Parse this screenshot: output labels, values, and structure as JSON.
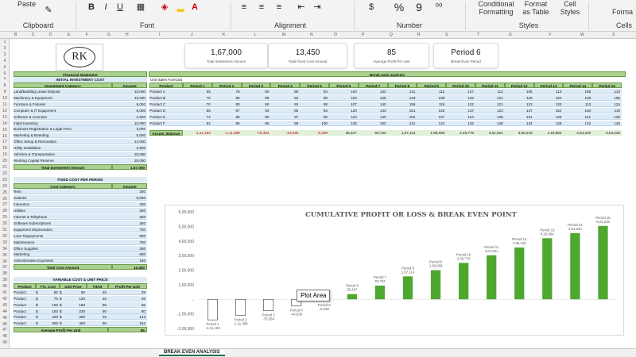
{
  "ribbon": {
    "paste_label": "Paste",
    "groups": [
      "Clipboard",
      "Font",
      "Alignment",
      "Number",
      "Styles",
      "Cells"
    ],
    "styles_buttons": [
      "Conditional Formatting",
      "Format as Table",
      "Cell Styles"
    ],
    "cells_button": "Forma",
    "number_symbols": [
      "%",
      "9"
    ]
  },
  "columns": [
    "B",
    "C",
    "D",
    "E",
    "F",
    "G",
    "H",
    "I",
    "J",
    "K",
    "L",
    "M",
    "N",
    "O",
    "P",
    "Q",
    "R",
    "S",
    "T",
    "U",
    "V",
    "W",
    "X"
  ],
  "rows": [
    "1",
    "2",
    "3",
    "4",
    "5",
    "6",
    "7",
    "8",
    "9",
    "10",
    "11",
    "12",
    "13",
    "14",
    "15",
    "16",
    "17",
    "18",
    "19",
    "20",
    "21",
    "22",
    "23",
    "24",
    "25",
    "26",
    "27",
    "28",
    "29",
    "30",
    "31",
    "32",
    "33",
    "34",
    "35",
    "36",
    "37",
    "38",
    "39",
    "40",
    "41",
    "42",
    "43",
    "44",
    "45",
    "46",
    "47",
    "48",
    "49"
  ],
  "logo_text": "RK",
  "kpis": [
    {
      "value": "1,67,000",
      "label": "Total Investment Amount"
    },
    {
      "value": "13,450",
      "label": "Total Fixed Cost Amount"
    },
    {
      "value": "85",
      "label": "Average Profit Per Unit"
    },
    {
      "value": "Period 6",
      "label": "Break Even Period"
    }
  ],
  "financial_statement": "Financial Statement",
  "break_even_title": "Break even analysis",
  "initial_investment": {
    "title": "INITIAL INVESTMENT COST",
    "col1": "Investment Category",
    "col2": "Amount",
    "rows": [
      [
        "Land/Building Lease Deposit",
        "15,000"
      ],
      [
        "Machinery & Equipment",
        "45,000"
      ],
      [
        "Furniture & Fixtures",
        "8,000"
      ],
      [
        "Computer & IT Equipment",
        "6,000"
      ],
      [
        "Software & Licenses",
        "2,500"
      ],
      [
        "Initial Inventory",
        "10,000"
      ],
      [
        "Business Registration & Legal Fees",
        "3,000"
      ],
      [
        "Marketing & Branding",
        "5,000"
      ],
      [
        "Office Setup & Renovation",
        "12,000"
      ],
      [
        "Utility Installation",
        "2,500"
      ],
      [
        "Vehicles & Transportation",
        "20,000"
      ],
      [
        "Working Capital Reserve",
        "20,000"
      ]
    ],
    "total_label": "Total Investment Amount",
    "total": "1,67,000"
  },
  "fixed_cost": {
    "title": "FIXED COST PER PERIOD",
    "col1": "Cost Category",
    "col2": "Amount",
    "rows": [
      [
        "Rent",
        "300"
      ],
      [
        "Salaries",
        "5,000"
      ],
      [
        "Insurance",
        "400"
      ],
      [
        "Utilities",
        "300"
      ],
      [
        "Internet & Telephone",
        "250"
      ],
      [
        "Software Subscriptions",
        "250"
      ],
      [
        "Equipment Depreciation",
        "700"
      ],
      [
        "Loan Repayments",
        "900"
      ],
      [
        "Maintenance",
        "700"
      ],
      [
        "Office Supplies",
        "300"
      ],
      [
        "Marketing",
        "600"
      ],
      [
        "Administrative Expenses",
        "150"
      ]
    ],
    "total_label": "Total Cost Amount",
    "total": "13,450"
  },
  "variable_cost": {
    "title": "VARIABLE COST & UNIT PRICE",
    "headers": [
      "Product",
      "TTL Cost",
      "Unit Price",
      "TtlAtt",
      "Profit Per Unit"
    ],
    "rows": [
      [
        "Product",
        "$",
        "50",
        "$",
        "80",
        "45",
        "29"
      ],
      [
        "Product",
        "$",
        "75",
        "$",
        "120",
        "45",
        "45"
      ],
      [
        "Product",
        "$",
        "100",
        "$",
        "160",
        "95",
        "55"
      ],
      [
        "Product",
        "$",
        "150",
        "$",
        "230",
        "90",
        "80"
      ],
      [
        "Product",
        "$",
        "200",
        "$",
        "350",
        "45",
        "143"
      ],
      [
        "Product",
        "$",
        "300",
        "$",
        "450",
        "90",
        "152"
      ]
    ],
    "avg_label": "Average Profit Per Unit",
    "avg": "85"
  },
  "unit_sales": {
    "title": "Unit Sales Forecast",
    "headers": [
      "Product",
      "Period 1",
      "Period 2",
      "Period 3",
      "Period 4",
      "Period 5",
      "Period 6",
      "Period 7",
      "Period 8",
      "Period 9",
      "Period 10",
      "Period 11",
      "Period 12",
      "Period 13",
      "Period 14",
      "Period 15"
    ],
    "rows": [
      [
        "Product A",
        "65",
        "78",
        "80",
        "90",
        "93",
        "100",
        "132",
        "141",
        "112",
        "127",
        "112",
        "105",
        "113",
        "165",
        "110"
      ],
      [
        "Product B",
        "76",
        "85",
        "89",
        "92",
        "98",
        "110",
        "125",
        "143",
        "109",
        "132",
        "121",
        "119",
        "122",
        "108",
        "105"
      ],
      [
        "Product C",
        "70",
        "80",
        "90",
        "93",
        "98",
        "107",
        "140",
        "156",
        "119",
        "122",
        "121",
        "123",
        "133",
        "113",
        "124"
      ],
      [
        "Product D",
        "85",
        "87",
        "93",
        "95",
        "93",
        "120",
        "143",
        "161",
        "102",
        "137",
        "123",
        "147",
        "152",
        "184",
        "119"
      ],
      [
        "Product E",
        "74",
        "86",
        "95",
        "97",
        "95",
        "110",
        "140",
        "154",
        "107",
        "124",
        "138",
        "151",
        "149",
        "121",
        "135"
      ],
      [
        "Product F",
        "82",
        "85",
        "96",
        "98",
        "100",
        "125",
        "152",
        "141",
        "124",
        "132",
        "146",
        "134",
        "148",
        "122",
        "145"
      ]
    ],
    "accum_label": "Accum. Balance",
    "accum": [
      "-1,41,183",
      "-1,11,388",
      "-78,384",
      "-44,836",
      "-9,339",
      "35,427",
      "93,732",
      "1,57,114",
      "1,99,699",
      "2,49,776",
      "3,01,821",
      "3,55,218",
      "4,18,964",
      "4,54,220",
      "5,03,225"
    ]
  },
  "chart_data": {
    "type": "bar",
    "title": "CUMULATIVE PROFIT OR LOSS & BREAK EVEN POINT",
    "categories": [
      "Period 1",
      "Period 2",
      "Period 3",
      "Period 4",
      "Period 5",
      "Period 6",
      "Period 7",
      "Period 8",
      "Period 9",
      "Period 10",
      "Period 11",
      "Period 12",
      "Period 13",
      "Period 14",
      "Period 15"
    ],
    "values": [
      -141183,
      -111388,
      -78384,
      -44836,
      -9339,
      35427,
      93732,
      157114,
      199699,
      249776,
      301821,
      355218,
      418964,
      454220,
      503225
    ],
    "value_labels": [
      "-1,41,183",
      "-1,11,388",
      "-78,384",
      "-44,836",
      "-9,339",
      "35,427",
      "93,732",
      "1,57,114",
      "1,99,699",
      "2,49,776",
      "3,01,821",
      "3,55,218",
      "4,18,964",
      "4,54,220",
      "5,03,225"
    ],
    "yticks": [
      "6,00,000",
      "5,00,000",
      "4,00,000",
      "3,00,000",
      "2,00,000",
      "1,00,000",
      "-",
      "-1,00,000",
      "-2,00,000"
    ],
    "ylim": [
      -200000,
      600000
    ],
    "positive_color": "#4ea72e",
    "negative_color": "#ffffff",
    "xlabel": "",
    "ylabel": ""
  },
  "tooltip": "Plot Area",
  "sheet_tab": "BREAK EVEN ANALYSIS"
}
